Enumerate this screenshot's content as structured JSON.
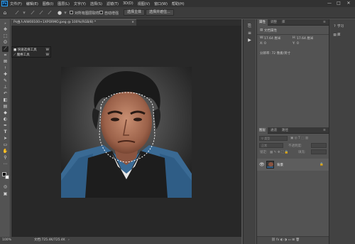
{
  "app": {
    "logo": "Ps",
    "menu": [
      "文件(F)",
      "编辑(E)",
      "图像(I)",
      "图层(L)",
      "文字(Y)",
      "选择(S)",
      "滤镜(T)",
      "3D(D)",
      "视图(V)",
      "窗口(W)",
      "帮助(H)"
    ],
    "window_controls": [
      "—",
      "□",
      "✕"
    ]
  },
  "options_bar": {
    "sample_all_layers": "对所有图层取样",
    "auto_enhance": "自动增强",
    "select_subject": "选择主体",
    "select_and_mask": "选择并遮住..."
  },
  "document": {
    "tab_title": "Ps由人AIW00100+1XPORMO.jpeg @ 100%(RGB/8) *",
    "close": "×"
  },
  "tool_flyout": {
    "items": [
      {
        "label": "快速选择工具",
        "key": "W"
      },
      {
        "label": "魔棒工具",
        "key": "W"
      }
    ]
  },
  "status": {
    "zoom": "100%",
    "doc_info": "文档:725.4K/725.4K"
  },
  "properties_panel": {
    "tabs": [
      "属性",
      "调整",
      "库"
    ],
    "doc_type": "文档属性",
    "w_label": "W:",
    "w_value": "17.64 厘米",
    "h_label": "H:",
    "h_value": "17.64 厘米",
    "x_label": "X:",
    "x_value": "0",
    "y_label": "Y:",
    "y_value": "0",
    "resolution": "分辨率: 72 像素/英寸"
  },
  "layers_panel": {
    "tabs": [
      "图层",
      "通道",
      "路径"
    ],
    "kind_label": "类型",
    "blend_mode": "正常",
    "opacity_label": "不透明度:",
    "lock_label": "锁定:",
    "fill_label": "填充:",
    "layer_name": "背景"
  },
  "side_panel": {
    "items": [
      {
        "icon": "?",
        "label": "学习"
      },
      {
        "icon": "▤",
        "label": "库"
      }
    ]
  }
}
